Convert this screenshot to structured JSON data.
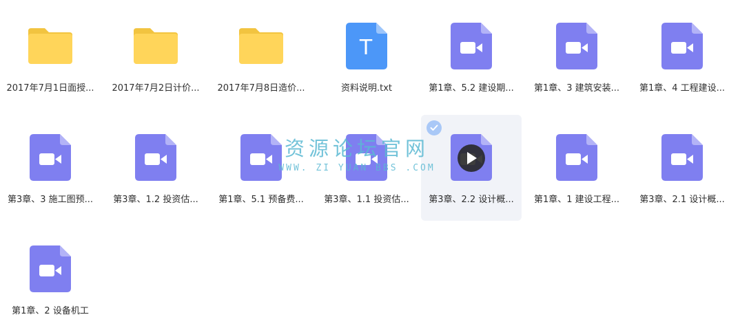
{
  "files": [
    {
      "name": "2017年7月1日面授...",
      "type": "folder",
      "selected": false
    },
    {
      "name": "2017年7月2日计价...",
      "type": "folder",
      "selected": false
    },
    {
      "name": "2017年7月8日造价...",
      "type": "folder",
      "selected": false
    },
    {
      "name": "资料说明.txt",
      "type": "text",
      "icon_letter": "T",
      "selected": false
    },
    {
      "name": "第1章、5.2 建设期...",
      "type": "video",
      "selected": false
    },
    {
      "name": "第1章、3 建筑安装...",
      "type": "video",
      "selected": false
    },
    {
      "name": "第1章、4 工程建设...",
      "type": "video",
      "selected": false
    },
    {
      "name": "第3章、3 施工图预...",
      "type": "video",
      "selected": false
    },
    {
      "name": "第3章、1.2 投资估...",
      "type": "video",
      "selected": false
    },
    {
      "name": "第1章、5.1 预备费...",
      "type": "video",
      "selected": false
    },
    {
      "name": "第3章、1.1 投资估...",
      "type": "video",
      "selected": false
    },
    {
      "name": "第3章、2.2 设计概...",
      "type": "video",
      "selected": true
    },
    {
      "name": "第1章、1 建设工程...",
      "type": "video",
      "selected": false
    },
    {
      "name": "第3章、2.1 设计概...",
      "type": "video",
      "selected": false
    },
    {
      "name": "第1章、2 设备机工",
      "type": "video",
      "selected": false
    }
  ],
  "watermark": {
    "title": "资源论坛官网",
    "url": "WWW. ZI YUAN BBS .COM"
  },
  "colors": {
    "folder": "#ffd55a",
    "folder_tab": "#f2c440",
    "video": "#7f7ff0",
    "video_fold": "#b3b3f7",
    "text_file": "#4c97f8",
    "text_fold": "#9cc5fb",
    "check": "#a9c8f7",
    "watermark": "#5ab9d2"
  }
}
